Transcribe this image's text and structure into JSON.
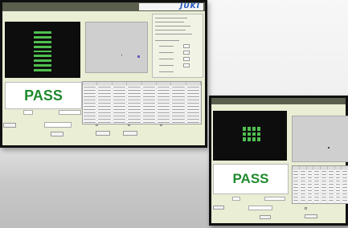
{
  "brand": {
    "logo": "JUKI",
    "caption": ""
  },
  "tabs": [
    "",
    "",
    ""
  ],
  "status": {
    "result": "PASS"
  },
  "group": {
    "title": ""
  },
  "fields": {
    "left_label": "",
    "mid_label": "",
    "search_label": ""
  },
  "buttons": {
    "start": "",
    "save": "",
    "stop": ""
  },
  "checkboxes": [
    "",
    "",
    ""
  ],
  "table": {
    "headers": [
      "",
      "",
      "",
      "",
      "",
      "",
      "",
      ""
    ],
    "row_count": 15,
    "row_count_small": 12
  },
  "colors": {
    "screen_bg": "#e9eed4",
    "topbar": "#5a5f4e",
    "pass_green": "#1f8a2c",
    "led_green": "#4fbf4f",
    "brand_blue": "#2255bb"
  }
}
